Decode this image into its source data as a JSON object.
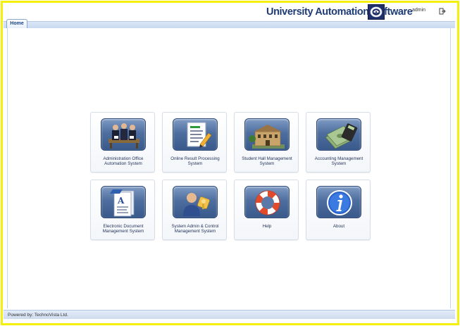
{
  "header": {
    "app_title": "University Automation Software",
    "user_name": "admin",
    "logo_icon": "university-seal-icon",
    "logout_icon": "logout-icon"
  },
  "tabs": [
    {
      "label": "Home",
      "active": true
    }
  ],
  "modules": [
    {
      "label_line1": "Administration Office",
      "label_line2": "Automation System",
      "icon": "office-staff-icon"
    },
    {
      "label_line1": "Online Result Processing",
      "label_line2": "System",
      "icon": "document-edit-icon"
    },
    {
      "label_line1": "Student Hall Management",
      "label_line2": "System",
      "icon": "hall-building-icon"
    },
    {
      "label_line1": "Accounting Management",
      "label_line2": "System",
      "icon": "money-calculator-icon"
    },
    {
      "label_line1": "Electronic Document",
      "label_line2": "Management System",
      "icon": "e-document-icon"
    },
    {
      "label_line1": "System Admin & Control",
      "label_line2": "Management System",
      "icon": "admin-user-key-icon"
    },
    {
      "label_line1": "Help",
      "label_line2": "",
      "icon": "lifebuoy-icon"
    },
    {
      "label_line1": "About",
      "label_line2": "",
      "icon": "info-icon"
    }
  ],
  "footer": {
    "text": "Powered by: TechnoVista Ltd."
  },
  "colors": {
    "frame_border": "#f4f00c",
    "title": "#1f3b76",
    "tile_icon_bg": "#4e6e9f"
  }
}
